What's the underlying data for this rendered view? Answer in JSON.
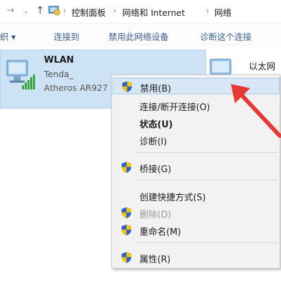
{
  "address_bar": {
    "breadcrumb": [
      "控制面板",
      "网络和 Internet",
      "网络"
    ]
  },
  "toolbar": {
    "organize_label": "织 ▾",
    "connect_to_label": "连接到",
    "disable_device_label": "禁用此网络设备",
    "diagnose_label": "诊断这个连接"
  },
  "connections": {
    "wlan": {
      "name": "WLAN",
      "ssid": "Tenda_",
      "adapter": "Atheros AR927"
    },
    "ethernet": {
      "name": "以太网"
    }
  },
  "context_menu": {
    "items": [
      {
        "label": "禁用(B)",
        "shield": true,
        "highlighted": true
      },
      {
        "label": "连接/断开连接(O)",
        "shield": false
      },
      {
        "label": "状态(U)",
        "shield": false,
        "bold": true
      },
      {
        "label": "诊断(I)",
        "shield": false
      },
      {
        "label": "桥接(G)",
        "shield": true
      },
      {
        "label": "创建快捷方式(S)",
        "shield": false
      },
      {
        "label": "删除(D)",
        "shield": true,
        "disabled": true
      },
      {
        "label": "重命名(M)",
        "shield": true
      },
      {
        "label": "属性(R)",
        "shield": true
      }
    ]
  },
  "colors": {
    "selection_bg": "#cde3f5",
    "menu_bg": "#f2f2f2",
    "menu_highlight": "#d7e7f6",
    "arrow_red": "#e53935",
    "link_blue": "#3a5d93"
  }
}
